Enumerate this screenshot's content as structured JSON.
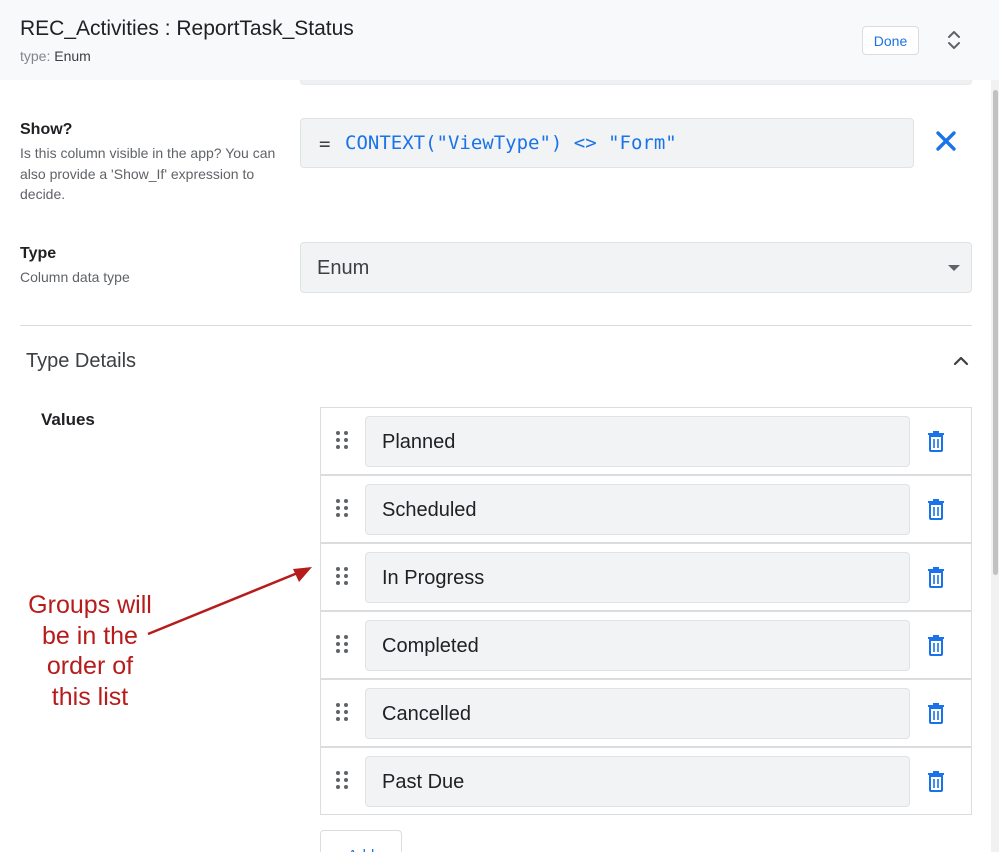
{
  "header": {
    "title": "REC_Activities : ReportTask_Status",
    "type_prefix": "type:",
    "type_value": "Enum",
    "done_label": "Done",
    "expand_icon": "unfold-icon"
  },
  "show": {
    "title": "Show?",
    "description": "Is this column visible in the app? You can also provide a 'Show_If' expression to decide.",
    "formula_prefix": "=",
    "formula": "CONTEXT(\"ViewType\") <> \"Form\"",
    "clear_icon": "close-icon"
  },
  "type": {
    "title": "Type",
    "description": "Column data type",
    "selected": "Enum"
  },
  "type_details": {
    "title": "Type Details",
    "values_label": "Values",
    "values": [
      {
        "label": "Planned"
      },
      {
        "label": "Scheduled"
      },
      {
        "label": "In Progress"
      },
      {
        "label": "Completed"
      },
      {
        "label": "Cancelled"
      },
      {
        "label": "Past Due"
      }
    ],
    "add_label": "Add"
  },
  "annotation": {
    "lines": [
      "Groups will",
      "be in the",
      "order of",
      "this list"
    ]
  },
  "colors": {
    "accent": "#1a73e8",
    "annotation": "#b71c1c",
    "header_bg": "#f8f9fa",
    "input_bg": "#f1f3f4"
  }
}
